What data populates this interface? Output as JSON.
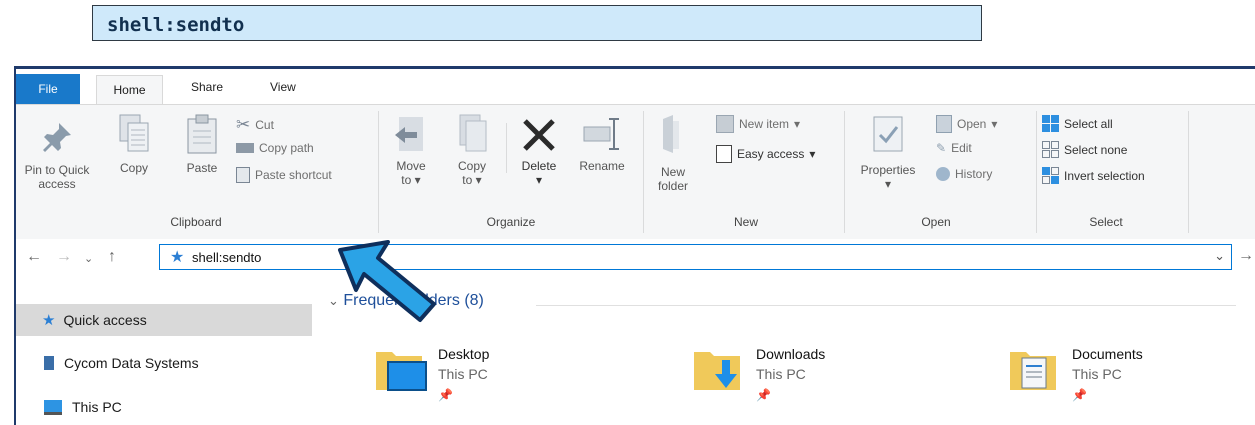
{
  "caption": {
    "text": "shell:sendto"
  },
  "tabs": [
    "File",
    "Home",
    "Share",
    "View"
  ],
  "ribbon": {
    "clipboard": {
      "pin_label_1": "Pin to Quick",
      "pin_label_2": "access",
      "copy": "Copy",
      "paste": "Paste",
      "cut": "Cut",
      "copy_path": "Copy path",
      "paste_shortcut": "Paste shortcut",
      "group": "Clipboard"
    },
    "organize": {
      "move_1": "Move",
      "move_2": "to",
      "copy_1": "Copy",
      "copy_2": "to",
      "delete": "Delete",
      "rename": "Rename",
      "group": "Organize"
    },
    "new": {
      "folder_1": "New",
      "folder_2": "folder",
      "new_item": "New item",
      "easy_access": "Easy access",
      "group": "New"
    },
    "open": {
      "properties": "Properties",
      "open": "Open",
      "edit": "Edit",
      "history": "History",
      "group": "Open"
    },
    "select": {
      "select_all": "Select all",
      "select_none": "Select none",
      "invert": "Invert selection",
      "group": "Select"
    }
  },
  "address": {
    "value": "shell:sendto"
  },
  "sidebar": [
    "Quick access",
    "Cycom Data Systems",
    "This PC"
  ],
  "content": {
    "section": "Frequent folders (8)",
    "folders": [
      {
        "name": "Desktop",
        "location": "This PC"
      },
      {
        "name": "Downloads",
        "location": "This PC"
      },
      {
        "name": "Documents",
        "location": "This PC"
      }
    ]
  },
  "colors": {
    "accent": "#1979ca",
    "caption_bg": "#cfe9fa",
    "arrow": "#2ba3e6",
    "window_frame": "#1f3a6b"
  }
}
